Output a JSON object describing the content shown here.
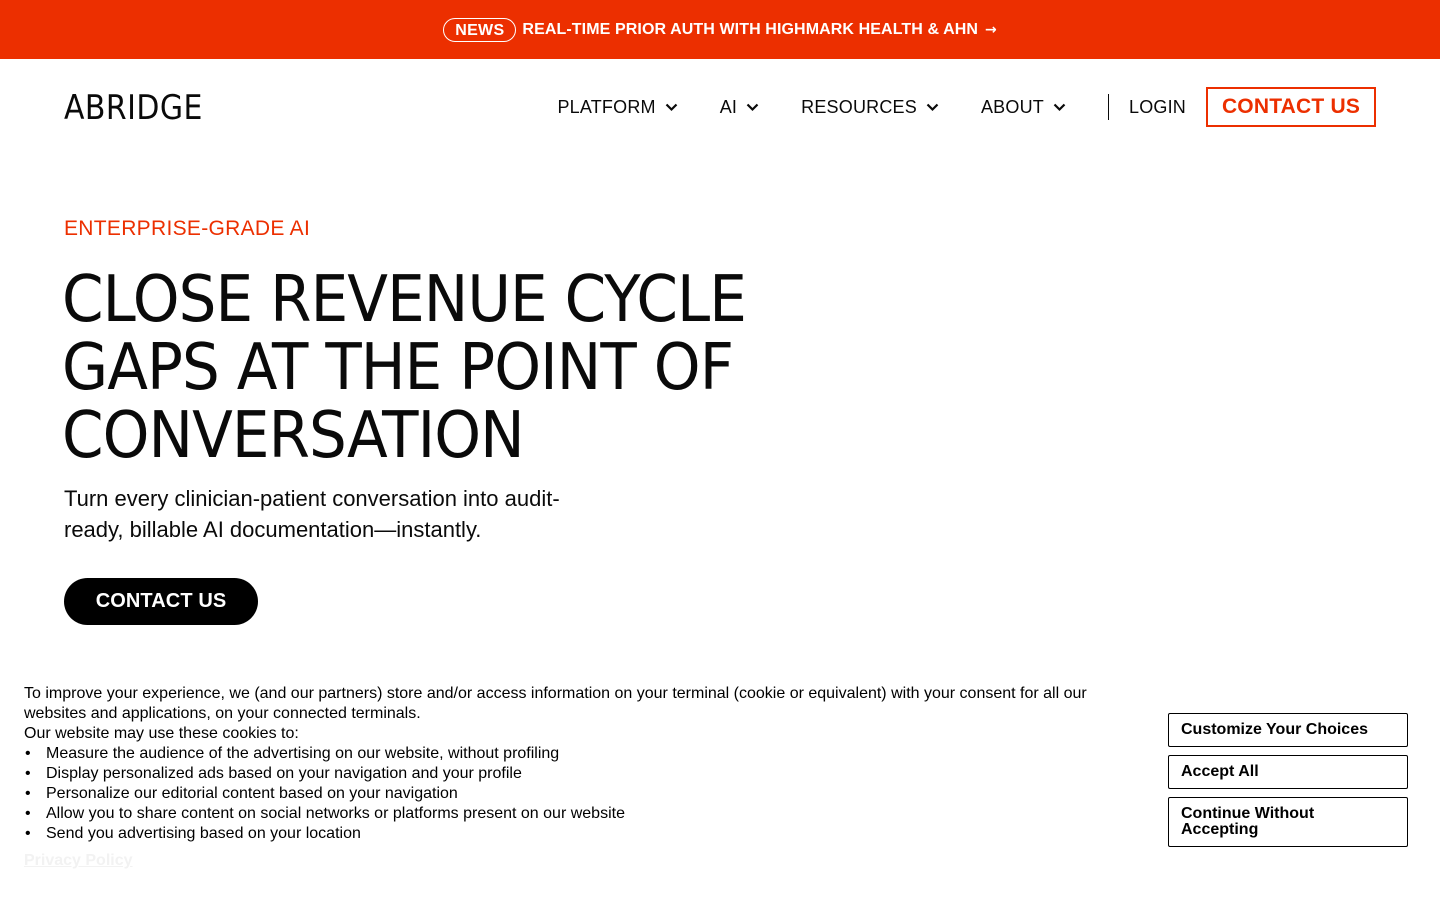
{
  "announcement": {
    "badge": "NEWS",
    "text": "REAL-TIME PRIOR AUTH WITH HIGHMARK HEALTH & AHN",
    "arrow": "→",
    "color": "#ec2f00"
  },
  "header": {
    "logo": "ABRIDGE",
    "nav": [
      {
        "label": "PLATFORM",
        "icon": "chevron-down-icon"
      },
      {
        "label": "AI",
        "icon": "chevron-down-icon"
      },
      {
        "label": "RESOURCES",
        "icon": "chevron-down-icon"
      },
      {
        "label": "ABOUT",
        "icon": "chevron-down-icon"
      }
    ],
    "login": "LOGIN",
    "contact": "CONTACT US"
  },
  "hero": {
    "eyebrow": "ENTERPRISE-GRADE AI",
    "headline_lines": [
      "CLOSE REVENUE CYCLE",
      "GAPS AT THE POINT OF",
      "CONVERSATION"
    ],
    "subhead_lines": [
      "Turn every clinician-patient conversation into audit-",
      "ready, billable AI documentation—instantly."
    ],
    "cta": "CONTACT US"
  },
  "cookie": {
    "intro_lines": [
      "To improve your experience, we (and our partners) store and/or access information on your terminal (cookie or equivalent) with your consent for all our",
      "websites and applications, on your connected terminals."
    ],
    "uses_intro": "Our website may use these cookies to:",
    "uses": [
      "Measure the audience of the advertising on our website, without profiling",
      "Display personalized ads based on your navigation and your profile",
      "Personalize our editorial content based on your navigation",
      "Allow you to share content on social networks or platforms present on our website",
      "Send you advertising based on your location"
    ],
    "privacy_link": "Privacy Policy",
    "buttons": {
      "customize": "Customize Your Choices",
      "accept": "Accept All",
      "continue": "Continue Without Accepting"
    }
  },
  "colors": {
    "brand_orange": "#ec2f00",
    "text": "#0a0a0a",
    "background": "#ffffff"
  }
}
